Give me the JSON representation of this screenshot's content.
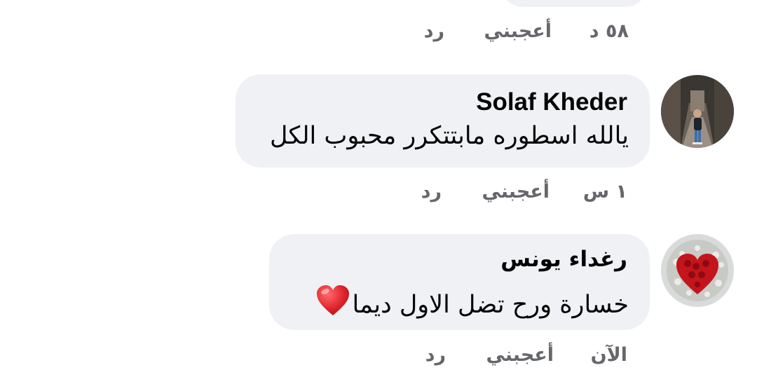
{
  "previous_comment": {
    "time": "٥٨ د",
    "like_label": "أعجبني",
    "reply_label": "رد"
  },
  "comments": [
    {
      "author": "Solaf Kheder",
      "text": "يالله اسطوره مابتتكرر محبوب الكل",
      "time": "١ س",
      "like_label": "أعجبني",
      "reply_label": "رد"
    },
    {
      "author": "رغداء يونس",
      "text": "خسارة  ورح تضل الاول ديما",
      "emoji": "red-heart-emoji",
      "time": "الآن",
      "like_label": "أعجبني",
      "reply_label": "رد"
    }
  ],
  "colors": {
    "bubble": "#eff1f4",
    "text": "#050505",
    "secondary": "#65676b",
    "heart": "#e0242c"
  }
}
